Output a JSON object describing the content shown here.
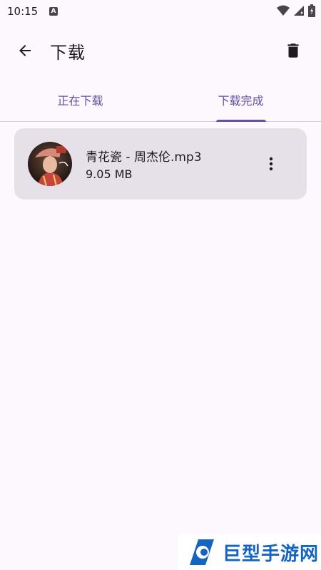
{
  "status_bar": {
    "time": "10:15",
    "notification_icon": "text-a-icon",
    "icons": [
      "wifi-icon",
      "signal-icon",
      "battery-icon"
    ]
  },
  "app_bar": {
    "title": "下载",
    "back_icon": "arrow-back-icon",
    "action_icon": "delete-icon"
  },
  "tabs": [
    {
      "label": "正在下载",
      "selected": false
    },
    {
      "label": "下载完成",
      "selected": true
    }
  ],
  "downloads": [
    {
      "title": "青花瓷 - 周杰伦.mp3",
      "size": "9.05 MB",
      "menu_icon": "more-vert-icon"
    }
  ],
  "watermark": {
    "text": "巨型手游网"
  },
  "colors": {
    "background": "#fdf7fe",
    "accent": "#6750a4",
    "card": "#e6e0e9",
    "text": "#1d1b20",
    "watermark": "#1565c0"
  }
}
